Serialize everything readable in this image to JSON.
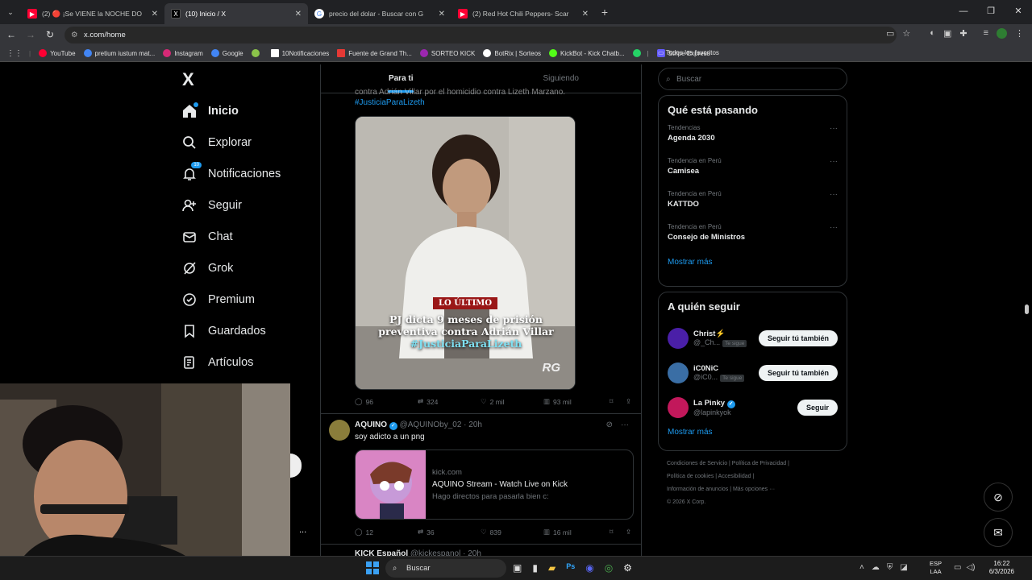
{
  "browser": {
    "tabs": [
      {
        "title": "(2) 🔴 ¡Se VIENE la NOCHE DO",
        "color": "#ff0033"
      },
      {
        "title": "(10) Inicio / X",
        "color": "#000000",
        "active": true
      },
      {
        "title": "precio del dolar - Buscar con G",
        "color": "#4285f4"
      },
      {
        "title": "(2) Red Hot Chili Peppers- Scar",
        "color": "#ff0033"
      }
    ],
    "url": "x.com/home",
    "bookmarks": [
      {
        "label": "YouTube",
        "color": "#ff0033"
      },
      {
        "label": "pretium iustum mat...",
        "color": "#4285f4"
      },
      {
        "label": "Instagram",
        "color": "#d62976"
      },
      {
        "label": "Google",
        "color": "#4285f4"
      },
      {
        "label": "",
        "color": "#888888"
      },
      {
        "label": "10Notificaciones",
        "color": "#ffffff"
      },
      {
        "label": "Fuente de Grand Th...",
        "color": "#e53935"
      },
      {
        "label": "SORTEO KICK",
        "color": "#9c27b0"
      },
      {
        "label": "BotRix | Sorteos",
        "color": "#ffffff"
      },
      {
        "label": "KickBot - Kick Chatb...",
        "color": "#53fc18"
      },
      {
        "label": "",
        "color": "#25d366"
      },
      {
        "label": "Stripe Express",
        "color": "#635bff"
      }
    ],
    "bookmarks_right": "Todos los favoritos"
  },
  "sidebar": {
    "logo": "X",
    "items": [
      {
        "label": "Inicio",
        "icon": "home-icon"
      },
      {
        "label": "Explorar",
        "icon": "search-icon"
      },
      {
        "label": "Notificaciones",
        "icon": "bell-icon",
        "badge": "10"
      },
      {
        "label": "Seguir",
        "icon": "add-user-icon"
      },
      {
        "label": "Chat",
        "icon": "mail-icon"
      },
      {
        "label": "Grok",
        "icon": "grok-icon"
      },
      {
        "label": "Premium",
        "icon": "verified-icon"
      },
      {
        "label": "Guardados",
        "icon": "bookmark-icon"
      },
      {
        "label": "Artículos",
        "icon": "article-icon"
      }
    ],
    "more": "..."
  },
  "feed": {
    "tabs": [
      "Para ti",
      "Siguiendo"
    ],
    "tweet1": {
      "text_line": "contra Adrián Villar por el homicidio contra Lizeth Marzano.",
      "hashtag": "#JusticiaParaLizeth",
      "media_badge": "LO ÚLTIMO",
      "media_caption1": "PJ dicta 9 meses de prisión",
      "media_caption2": "preventiva contra Adrián Villar",
      "media_hashtag": "#JusticiaParaLizeth",
      "media_logo": "RG",
      "replies": "96",
      "retweets": "324",
      "likes": "2 mil",
      "views": "93 mil"
    },
    "tweet2": {
      "name": "AQUINO",
      "handle": "@AQUINOby_02 · 20h",
      "text": "soy adicto a un png",
      "card_domain": "kick.com",
      "card_title": "AQUINO Stream - Watch Live on Kick",
      "card_desc": "Hago directos para pasarla bien c:",
      "replies": "12",
      "retweets": "36",
      "likes": "839",
      "views": "16 mil"
    },
    "tweet3": {
      "name": "KICK Español",
      "handle": "@kickespanol · 20h"
    }
  },
  "right": {
    "search_placeholder": "Buscar",
    "trends_title": "Qué está pasando",
    "trends": [
      {
        "category": "Tendencias",
        "name": "Agenda 2030"
      },
      {
        "category": "Tendencia en Perú",
        "name": "Camisea"
      },
      {
        "category": "Tendencia en Perú",
        "name": "KATTDO"
      },
      {
        "category": "Tendencia en Perú",
        "name": "Consejo de Ministros"
      }
    ],
    "show_more": "Mostrar más",
    "who_title": "A quién seguir",
    "who": [
      {
        "name": "Christ⚡",
        "handle": "@_Ch...",
        "tag": "Te sigue",
        "button": "Seguir tú también",
        "color": "#4a1fa8"
      },
      {
        "name": "iC0NiC",
        "handle": "@iC0...",
        "tag": "Te sigue",
        "button": "Seguir tú también",
        "color": "#3a6ea5"
      },
      {
        "name": "La Pinky",
        "handle": "@lapinkyok",
        "tag": "",
        "button": "Seguir",
        "color": "#c2185b"
      }
    ],
    "who_more": "Mostrar más",
    "footer1": "Condiciones de Servicio  |  Política de Privacidad  |",
    "footer2": "Política de cookies  |  Accesibilidad  |",
    "footer3": "Información de anuncios  |  Más opciones ···",
    "footer4": "© 2026 X Corp."
  },
  "taskbar": {
    "search": "Buscar",
    "lang1": "ESP",
    "lang2": "LAA",
    "time": "16:22",
    "date": "6/3/2026"
  }
}
